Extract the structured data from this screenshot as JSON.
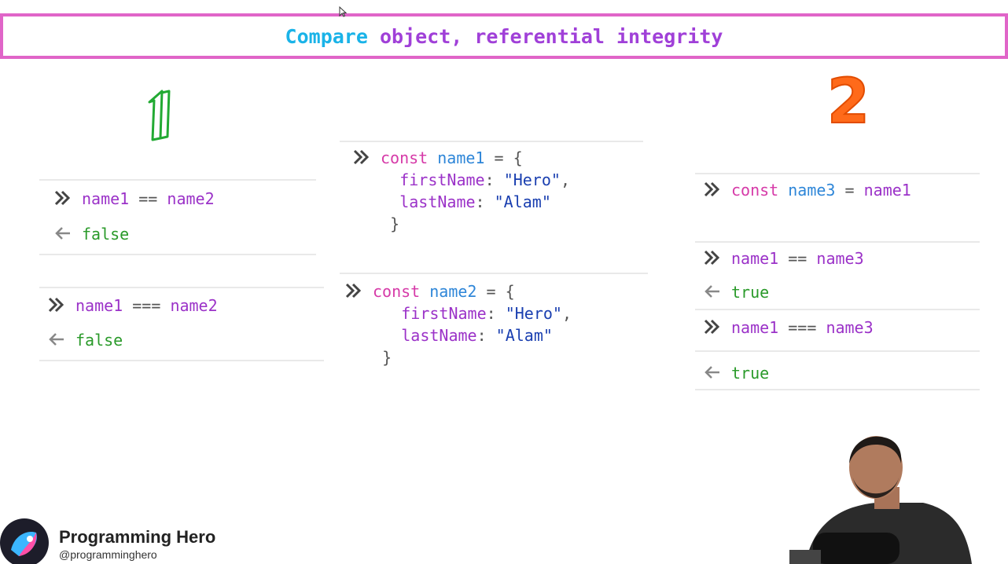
{
  "title": {
    "part1": "Compare",
    "part2": " object, referential integrity"
  },
  "markers": {
    "left": "1",
    "right": "2"
  },
  "left_panel": {
    "block1": {
      "lhs": "name1",
      "op": "==",
      "rhs": "name2",
      "result": "false"
    },
    "block2": {
      "lhs": "name1",
      "op": "===",
      "rhs": "name2",
      "result": "false"
    }
  },
  "middle_panel": {
    "obj1": {
      "keyword": "const",
      "name": "name1",
      "eq": "=",
      "open": "{",
      "first_key": "firstName",
      "first_val": "\"Hero\"",
      "last_key": "lastName",
      "last_val": "\"Alam\"",
      "close": "}"
    },
    "obj2": {
      "keyword": "const",
      "name": "name2",
      "eq": "=",
      "open": "{",
      "first_key": "firstName",
      "first_val": "\"Hero\"",
      "last_key": "lastName",
      "last_val": "\"Alam\"",
      "close": "}"
    }
  },
  "right_panel": {
    "assign": {
      "keyword": "const",
      "name": "name3",
      "eq": "=",
      "value": "name1"
    },
    "cmp1": {
      "lhs": "name1",
      "op": "==",
      "rhs": "name3",
      "result": "true"
    },
    "cmp2": {
      "lhs": "name1",
      "op": "===",
      "rhs": "name3",
      "result": "true"
    }
  },
  "brand": {
    "name": "Programming Hero",
    "handle": "@programminghero"
  },
  "colors": {
    "title_border": "#e065c8",
    "title_cyan": "#1ab3e8",
    "title_purple": "#a040d8",
    "keyword": "#d63aa8",
    "variable": "#2e86d8",
    "property": "#9b32c8",
    "string": "#1a3fb0",
    "result": "#2a9a2a",
    "marker_one": "#22aa33",
    "marker_two": "#ff6a1a"
  },
  "icons": {
    "prompt": "double-chevron-right-icon",
    "result": "arrow-left-icon",
    "cursor": "mouse-pointer-icon"
  }
}
